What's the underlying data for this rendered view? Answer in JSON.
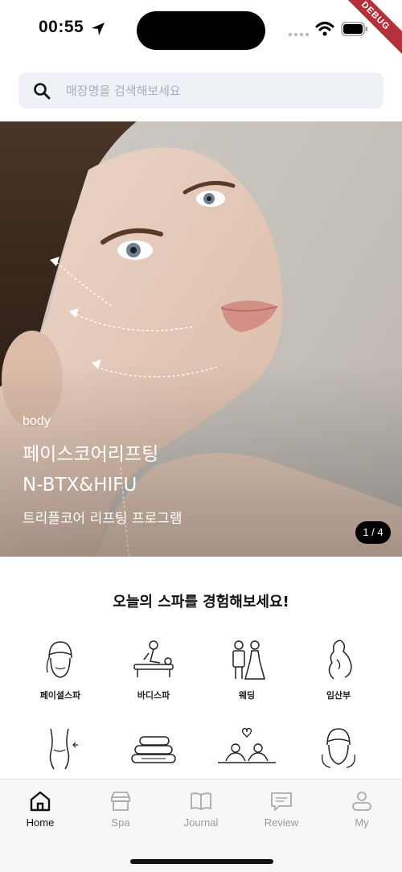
{
  "status_bar": {
    "time": "00:55",
    "debug_label": "DEBUG"
  },
  "search": {
    "placeholder": "매장명을 검색해보세요",
    "icon": "search-icon"
  },
  "banner": {
    "tag": "body",
    "title_line1": "페이스코어리프팅",
    "title_line2": "N-BTX&HIFU",
    "subtitle": "트리플코어 리프팅 프로그램",
    "pager": "1 / 4"
  },
  "section": {
    "title": "오늘의 스파를 경험해보세요!",
    "categories": [
      {
        "label": "페이셜스파",
        "icon": "towel-head-icon"
      },
      {
        "label": "바디스파",
        "icon": "massage-icon"
      },
      {
        "label": "웨딩",
        "icon": "wedding-couple-icon"
      },
      {
        "label": "임산부",
        "icon": "pregnant-icon"
      },
      {
        "label": "",
        "icon": "body-slim-icon"
      },
      {
        "label": "",
        "icon": "stacked-towels-icon"
      },
      {
        "label": "",
        "icon": "couple-spa-icon"
      },
      {
        "label": "",
        "icon": "head-wrap-icon"
      }
    ]
  },
  "tabs": [
    {
      "label": "Home",
      "icon": "home-icon",
      "active": true
    },
    {
      "label": "Spa",
      "icon": "shop-icon",
      "active": false
    },
    {
      "label": "Journal",
      "icon": "book-icon",
      "active": false
    },
    {
      "label": "Review",
      "icon": "chat-icon",
      "active": false
    },
    {
      "label": "My",
      "icon": "user-icon",
      "active": false
    }
  ],
  "colors": {
    "accent": "#111111",
    "inactive": "#9a9a9a",
    "search_bg": "#eef1f6",
    "debug": "#b4303a"
  }
}
